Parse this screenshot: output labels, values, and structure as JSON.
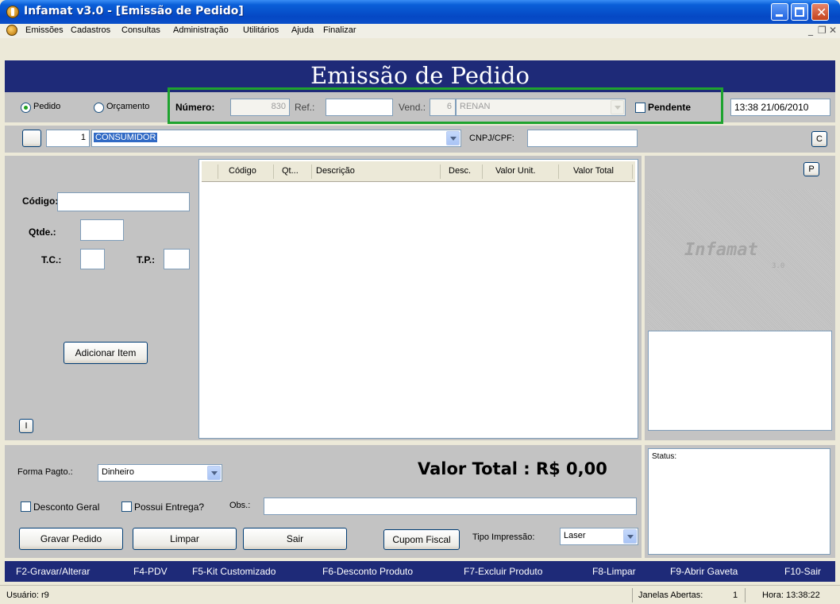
{
  "window": {
    "title": "Infamat v3.0 - [Emissão de Pedido]"
  },
  "menu": [
    "Emissões",
    "Cadastros",
    "Consultas",
    "Administração",
    "Utilitários",
    "Ajuda",
    "Finalizar"
  ],
  "banner": {
    "title": "Emissão de Pedido"
  },
  "order": {
    "radio_pedido": "Pedido",
    "radio_orcamento": "Orçamento",
    "numero_label": "Número:",
    "numero_value": "830",
    "ref_label": "Ref.:",
    "ref_value": "",
    "vend_label": "Vend.:",
    "vend_code": "6",
    "vend_name": "RENAN",
    "pendente_label": "Pendente",
    "datetime": "13:38 21/06/2010"
  },
  "customer": {
    "code": "1",
    "name": "CONSUMIDOR",
    "cnpj_label": "CNPJ/CPF:",
    "cnpj_value": "",
    "c_button": "C"
  },
  "item_entry": {
    "codigo_label": "Código:",
    "qtde_label": "Qtde.:",
    "tc_label": "T.C.:",
    "tp_label": "T.P.:",
    "add_button": "Adicionar Item",
    "i_button": "I"
  },
  "grid": {
    "columns": [
      "Código",
      "Qt...",
      "Descrição",
      "Desc.",
      "Valor Unit.",
      "Valor Total"
    ],
    "rows": []
  },
  "side": {
    "p_button": "P",
    "logo_text": "Infamat",
    "logo_version": "3.0"
  },
  "footer": {
    "forma_label": "Forma Pagto.:",
    "forma_value": "Dinheiro",
    "valor_total": "Valor Total : R$ 0,00",
    "desconto_label": "Desconto Geral",
    "entrega_label": "Possui Entrega?",
    "obs_label": "Obs.:",
    "obs_value": "",
    "gravar": "Gravar Pedido",
    "limpar": "Limpar",
    "sair": "Sair",
    "cupom": "Cupom Fiscal",
    "tipo_label": "Tipo Impressão:",
    "tipo_value": "Laser",
    "status_label": "Status:"
  },
  "fkeys": [
    "F2-Gravar/Alterar",
    "F4-PDV",
    "F5-Kit Customizado",
    "F6-Desconto Produto",
    "F7-Excluir Produto",
    "F8-Limpar",
    "F9-Abrir Gaveta",
    "F10-Sair"
  ],
  "statusbar": {
    "usuario": "Usuário: r9",
    "janelas_label": "Janelas Abertas:",
    "janelas_value": "1",
    "hora": "Hora: 13:38:22"
  },
  "colors": {
    "banner": "#1e2a78",
    "highlight_box": "#1fa32f",
    "panel": "#c3c3c3"
  }
}
